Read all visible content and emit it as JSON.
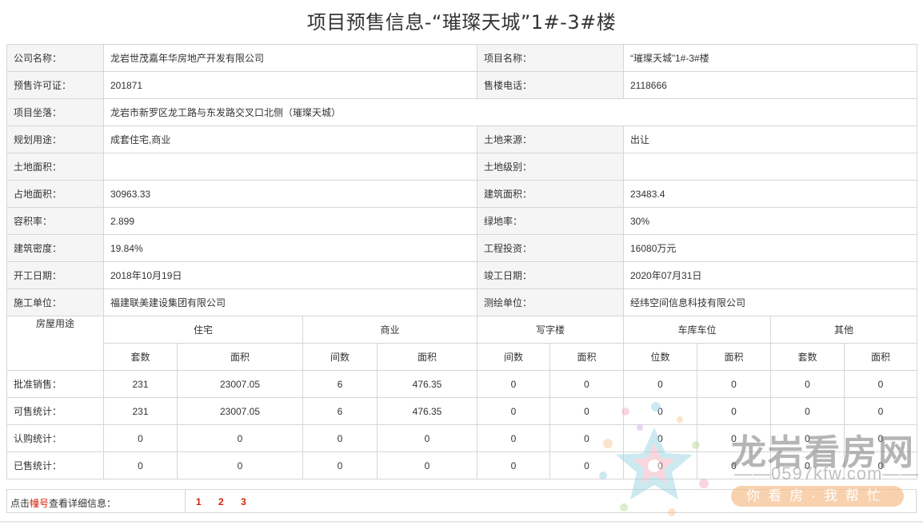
{
  "page_title": "项目预售信息-“璀璨天城”1#-3#楼",
  "info_rows": [
    {
      "l1": "公司名称：",
      "v1": "龙岩世茂嘉年华房地产开发有限公司",
      "l2": "项目名称：",
      "v2": "“璀璨天城”1#-3#楼"
    },
    {
      "l1": "预售许可证：",
      "v1": "201871",
      "l2": "售楼电话：",
      "v2": "2118666"
    },
    {
      "l1": "规划用途：",
      "v1": "成套住宅,商业",
      "l2": "土地来源：",
      "v2": "出让"
    },
    {
      "l1": "土地面积：",
      "v1": "",
      "l2": "土地级别：",
      "v2": ""
    },
    {
      "l1": "占地面积：",
      "v1": "30963.33",
      "l2": "建筑面积：",
      "v2": "23483.4"
    },
    {
      "l1": "容积率：",
      "v1": "2.899",
      "l2": "绿地率：",
      "v2": "30%"
    },
    {
      "l1": "建筑密度：",
      "v1": "19.84%",
      "l2": "工程投资：",
      "v2": "16080万元"
    },
    {
      "l1": "开工日期：",
      "v1": "2018年10月19日",
      "l2": "竣工日期：",
      "v2": "2020年07月31日"
    },
    {
      "l1": "施工单位：",
      "v1": "福建联美建设集团有限公司",
      "l2": "测绘单位：",
      "v2": "经纬空间信息科技有限公司"
    }
  ],
  "location": {
    "label": "项目坐落：",
    "value": "龙岩市新罗区龙工路与东发路交叉口北侧（璀璨天城）"
  },
  "usage": {
    "header": "房屋用途",
    "groups": [
      "住宅",
      "商业",
      "写字楼",
      "车库车位",
      "其他"
    ],
    "subheaders": [
      "套数",
      "面积",
      "间数",
      "面积",
      "间数",
      "面积",
      "位数",
      "面积",
      "套数",
      "面积"
    ],
    "rows": [
      {
        "label": "批准销售：",
        "values": [
          "231",
          "23007.05",
          "6",
          "476.35",
          "0",
          "0",
          "0",
          "0",
          "0",
          "0"
        ]
      },
      {
        "label": "可售统计：",
        "values": [
          "231",
          "23007.05",
          "6",
          "476.35",
          "0",
          "0",
          "0",
          "0",
          "0",
          "0"
        ]
      },
      {
        "label": "认购统计：",
        "values": [
          "0",
          "0",
          "0",
          "0",
          "0",
          "0",
          "0",
          "0",
          "0",
          "0"
        ]
      },
      {
        "label": "已售统计：",
        "values": [
          "0",
          "0",
          "0",
          "0",
          "0",
          "0",
          "0",
          "0",
          "0",
          "0"
        ]
      }
    ]
  },
  "footer": {
    "prefix": "点击",
    "highlight": "幢号",
    "suffix": "查看详细信息：",
    "buildings": [
      "1",
      "2",
      "3"
    ]
  },
  "watermark": {
    "brand": "龙岩看房网",
    "domain": "——0597kfw.com——",
    "slogan": "你看房·我帮忙"
  },
  "colors": {
    "accent_red": "#d81e06",
    "label_bg": "#f5f5f5",
    "border": "#d6d6d6"
  }
}
